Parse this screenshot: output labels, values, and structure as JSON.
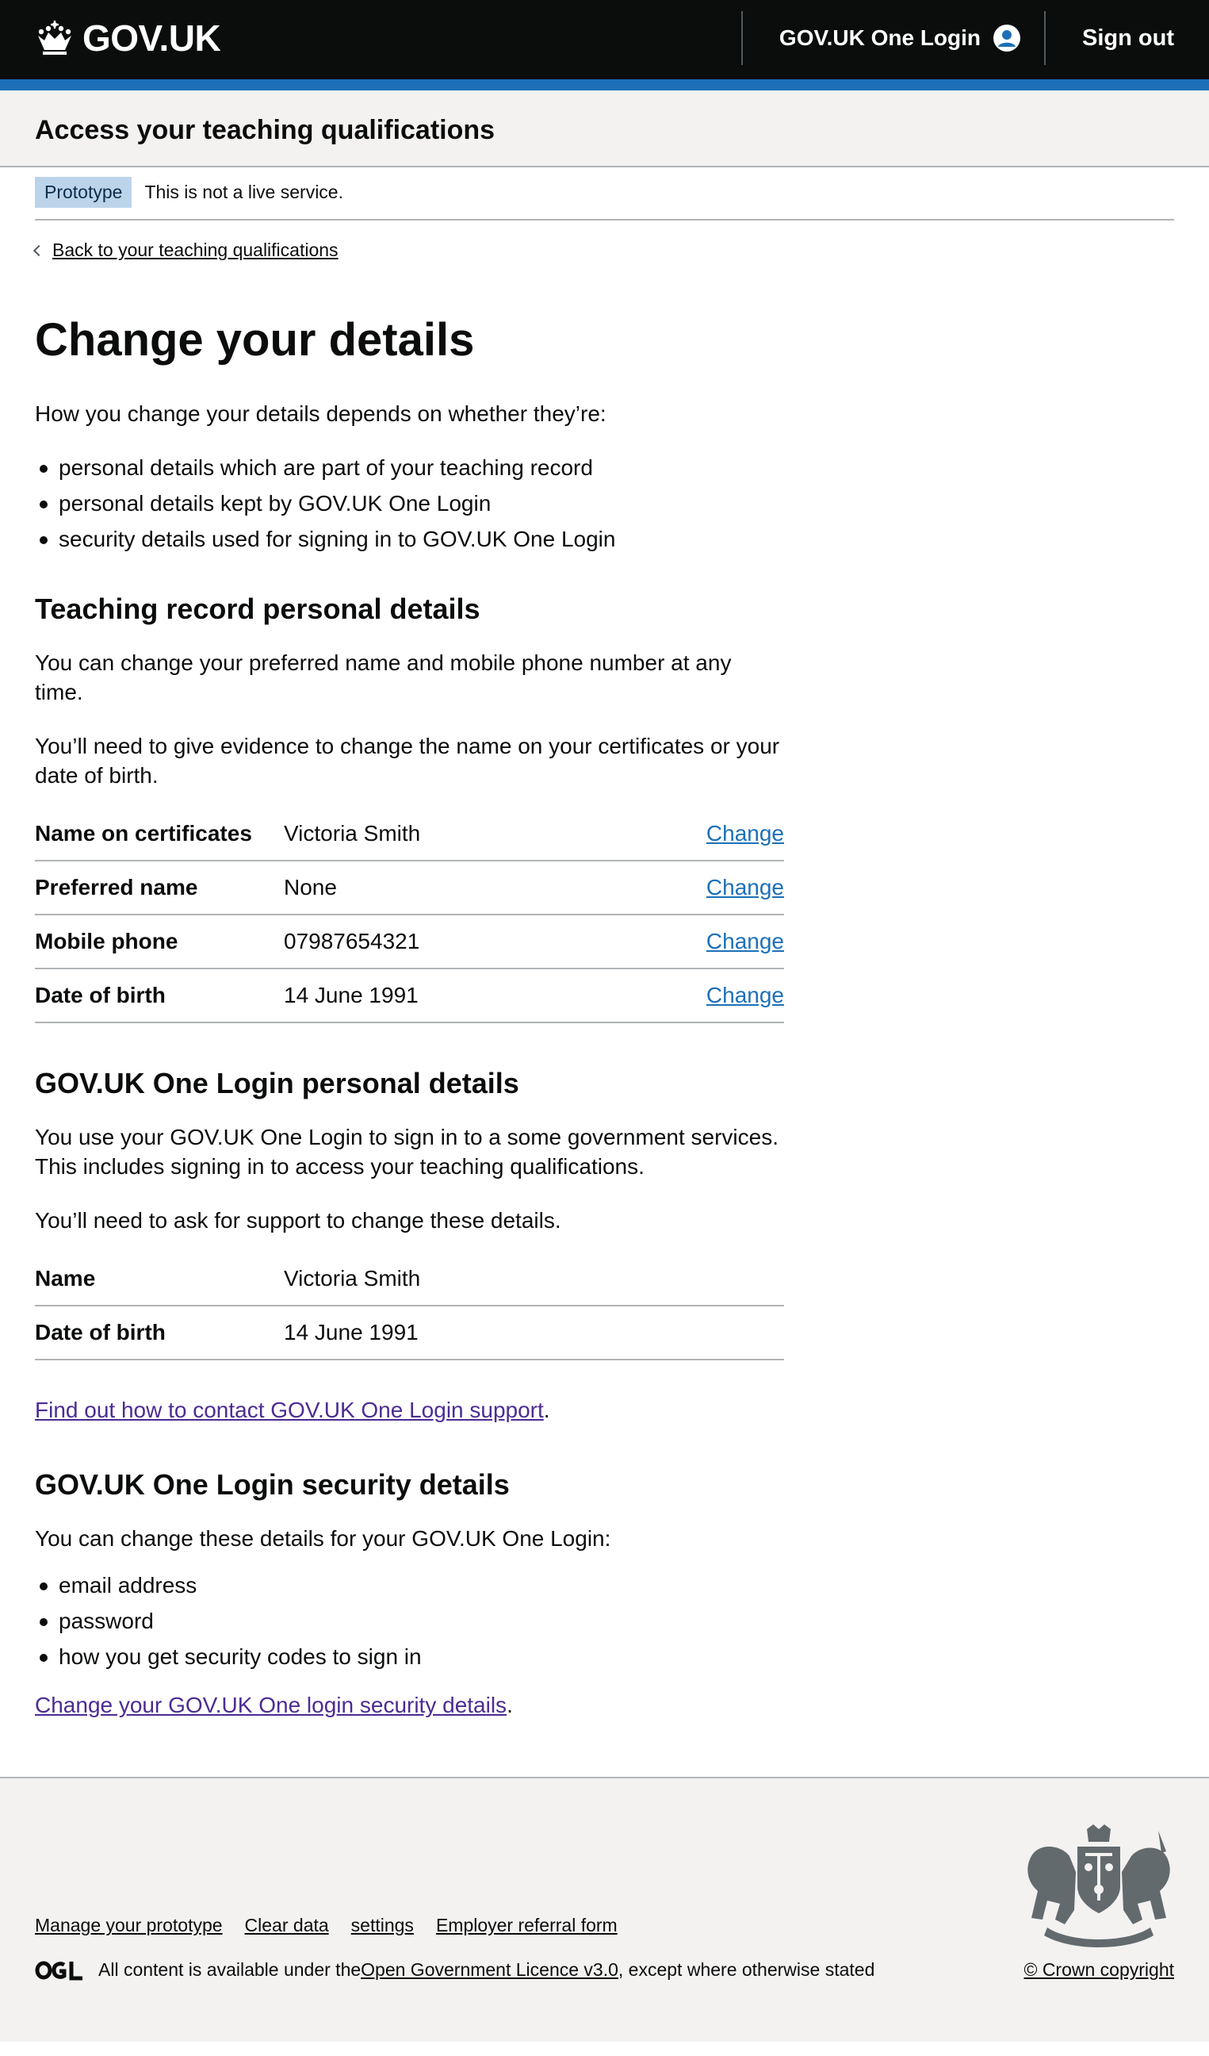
{
  "header": {
    "logo_text": "GOV.UK",
    "one_login_label": "GOV.UK One Login",
    "sign_out_label": "Sign out"
  },
  "service": {
    "title": "Access your teaching qualifications"
  },
  "phase_banner": {
    "tag": "Prototype",
    "text": "This is not a live service."
  },
  "back_link": "Back to your teaching qualifications",
  "page_title": "Change your details",
  "intro": {
    "text": "How you change your details depends on whether they’re:",
    "items": [
      "personal details which are part of your teaching record",
      "personal details kept by GOV.UK One Login",
      "security details used for signing in to GOV.UK One Login"
    ]
  },
  "teaching_record": {
    "heading": "Teaching record personal details",
    "para1": "You can change your preferred name and mobile phone number at any time.",
    "para2": "You’ll need to give evidence to change the name on your certificates or your date of birth.",
    "rows": [
      {
        "key": "Name on certificates",
        "value": "Victoria Smith",
        "action": "Change"
      },
      {
        "key": "Preferred name",
        "value": "None",
        "action": "Change"
      },
      {
        "key": "Mobile phone",
        "value": "07987654321",
        "action": "Change"
      },
      {
        "key": "Date of birth",
        "value": "14 June 1991",
        "action": "Change"
      }
    ]
  },
  "one_login_personal": {
    "heading": "GOV.UK One Login personal details",
    "para1": "You use your GOV.UK One Login to sign in to a some government services. This includes signing in to access your teaching qualifications.",
    "para2": "You’ll need to ask for support to change these details.",
    "rows": [
      {
        "key": "Name",
        "value": "Victoria Smith"
      },
      {
        "key": "Date of birth",
        "value": "14 June 1991"
      }
    ],
    "support_link": "Find out how to contact GOV.UK One Login support",
    "support_suffix": "."
  },
  "one_login_security": {
    "heading": "GOV.UK One Login security details",
    "para": "You can change these details for your GOV.UK One Login:",
    "items": [
      "email address",
      "password",
      "how you get security codes to sign in"
    ],
    "change_link": "Change your GOV.UK One login security details",
    "change_suffix": "."
  },
  "footer": {
    "links": [
      "Manage your prototype",
      "Clear data",
      "settings",
      "Employer referral form"
    ],
    "licence_prefix": "All content is available under the ",
    "licence_link": "Open Government Licence v3.0",
    "licence_suffix": ", except where otherwise stated",
    "copyright": "© Crown copyright"
  },
  "colors": {
    "header_bg": "#0b0c0c",
    "brand_blue": "#1d70b8",
    "link_blue": "#1d70b8",
    "visited_purple": "#4c2c92",
    "service_bg": "#f3f2f1",
    "phase_tag_bg": "#bbd4ea",
    "border_grey": "#b1b4b6"
  }
}
